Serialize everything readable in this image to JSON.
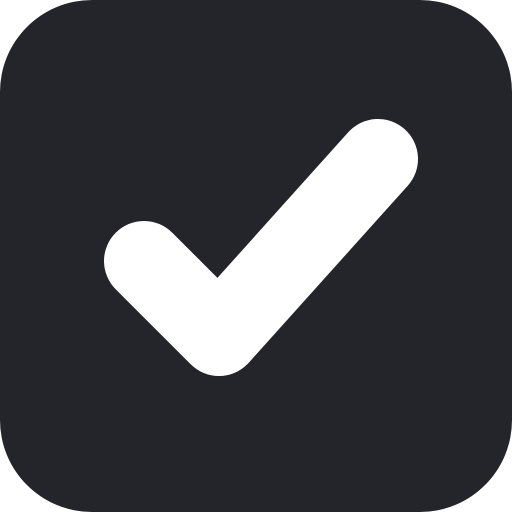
{
  "checkbox": {
    "checked": true,
    "icon": "checkmark-icon",
    "colors": {
      "background": "#24252b",
      "check": "#ffffff"
    }
  }
}
